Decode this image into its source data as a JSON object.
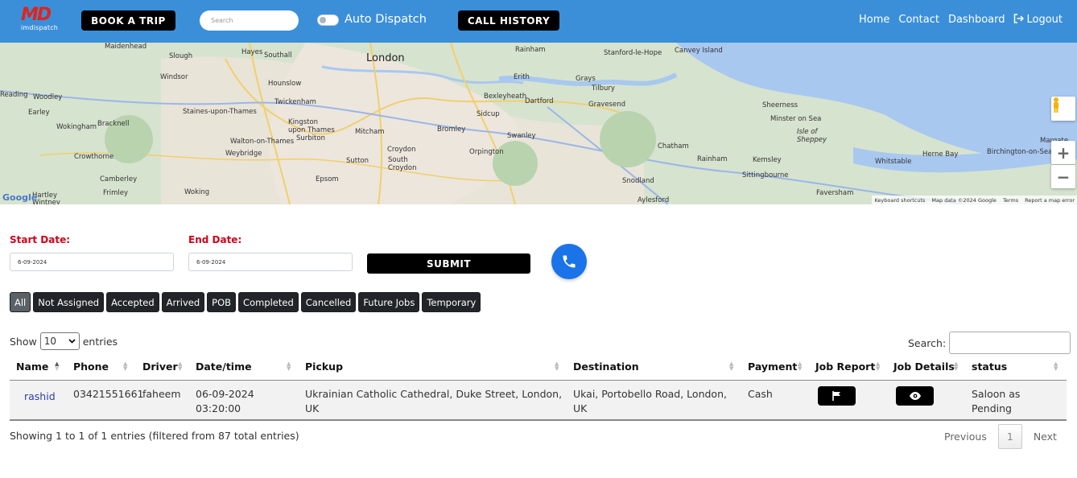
{
  "navbar": {
    "logo_text": "MD",
    "brand": "imdispatch",
    "book_trip": "BOOK A TRIP",
    "search_placeholder": "Search",
    "auto_dispatch_label": "Auto Dispatch",
    "auto_dispatch_on": false,
    "call_history": "CALL HISTORY",
    "links": [
      "Home",
      "Contact",
      "Dashboard",
      "Logout"
    ]
  },
  "map": {
    "labels": [
      "Maidenhead",
      "Hayes",
      "Southall",
      "London",
      "Rainham",
      "Stanford-le-Hope",
      "Canvey Island",
      "Slough",
      "Windsor",
      "Hounslow",
      "Erith",
      "Grays",
      "Tilbury",
      "Reading",
      "Woodley",
      "Twickenham",
      "Bexleyheath",
      "Dartford",
      "Gravesend",
      "Sheerness",
      "Earley",
      "Wokingham",
      "Bracknell",
      "Staines-upon-Thames",
      "Kingston upon Thames",
      "Mitcham",
      "Bromley",
      "Sidcup",
      "Minster on Sea",
      "Isle of Sheppey",
      "Walton-on-Thames",
      "Surbiton",
      "Swanley",
      "Weybridge",
      "Croydon",
      "Orpington",
      "Chatham",
      "Crowthorne",
      "Sutton",
      "South Croydon",
      "Rainham",
      "Kemsley",
      "Herne Bay",
      "Whitstable",
      "Birchington-on-Sea",
      "Camberley",
      "Epsom",
      "Sittingbourne",
      "Frimley",
      "Woking",
      "Snodland",
      "Faversham",
      "Hartley Wintney",
      "Aylesford",
      "Margate"
    ],
    "google": "Google",
    "attribution": [
      "Keyboard shortcuts",
      "Map data ©2024 Google",
      "Terms",
      "Report a map error"
    ],
    "zoom_in": "+",
    "zoom_out": "−"
  },
  "filter": {
    "start_label": "Start Date:",
    "start_value": "6-09-2024",
    "end_label": "End Date:",
    "end_value": "6-09-2024",
    "submit": "SUBMIT"
  },
  "tabs": [
    "All",
    "Not Assigned",
    "Accepted",
    "Arrived",
    "POB",
    "Completed",
    "Cancelled",
    "Future Jobs",
    "Temporary"
  ],
  "active_tab": "All",
  "table_controls": {
    "show": "Show",
    "entries_value": "10",
    "entries": "entries",
    "search_label": "Search:"
  },
  "table": {
    "headers": [
      "Name",
      "Phone",
      "Driver",
      "Date/time",
      "Pickup",
      "Destination",
      "Payment",
      "Job Report",
      "Job Details",
      "status"
    ],
    "rows": [
      {
        "name": "rashid",
        "phone": "03421551661",
        "driver": "faheem",
        "date": "06-09-2024",
        "time": "03:20:00",
        "pickup_line1": "Ukrainian Catholic Cathedral, Duke Street, London,",
        "pickup_line2": "UK",
        "dest_line1": "Ukai, Portobello Road, London,",
        "dest_line2": "UK",
        "payment": "Cash",
        "status_line1": "Saloon as",
        "status_line2": "Pending"
      }
    ]
  },
  "footer": {
    "info": "Showing 1 to 1 of 1 entries (filtered from 87 total entries)",
    "previous": "Previous",
    "page": "1",
    "next": "Next"
  },
  "colors": {
    "navbar": "#3b8fd9",
    "accent_red": "#d0021b",
    "phone_blue": "#1a73e8"
  }
}
